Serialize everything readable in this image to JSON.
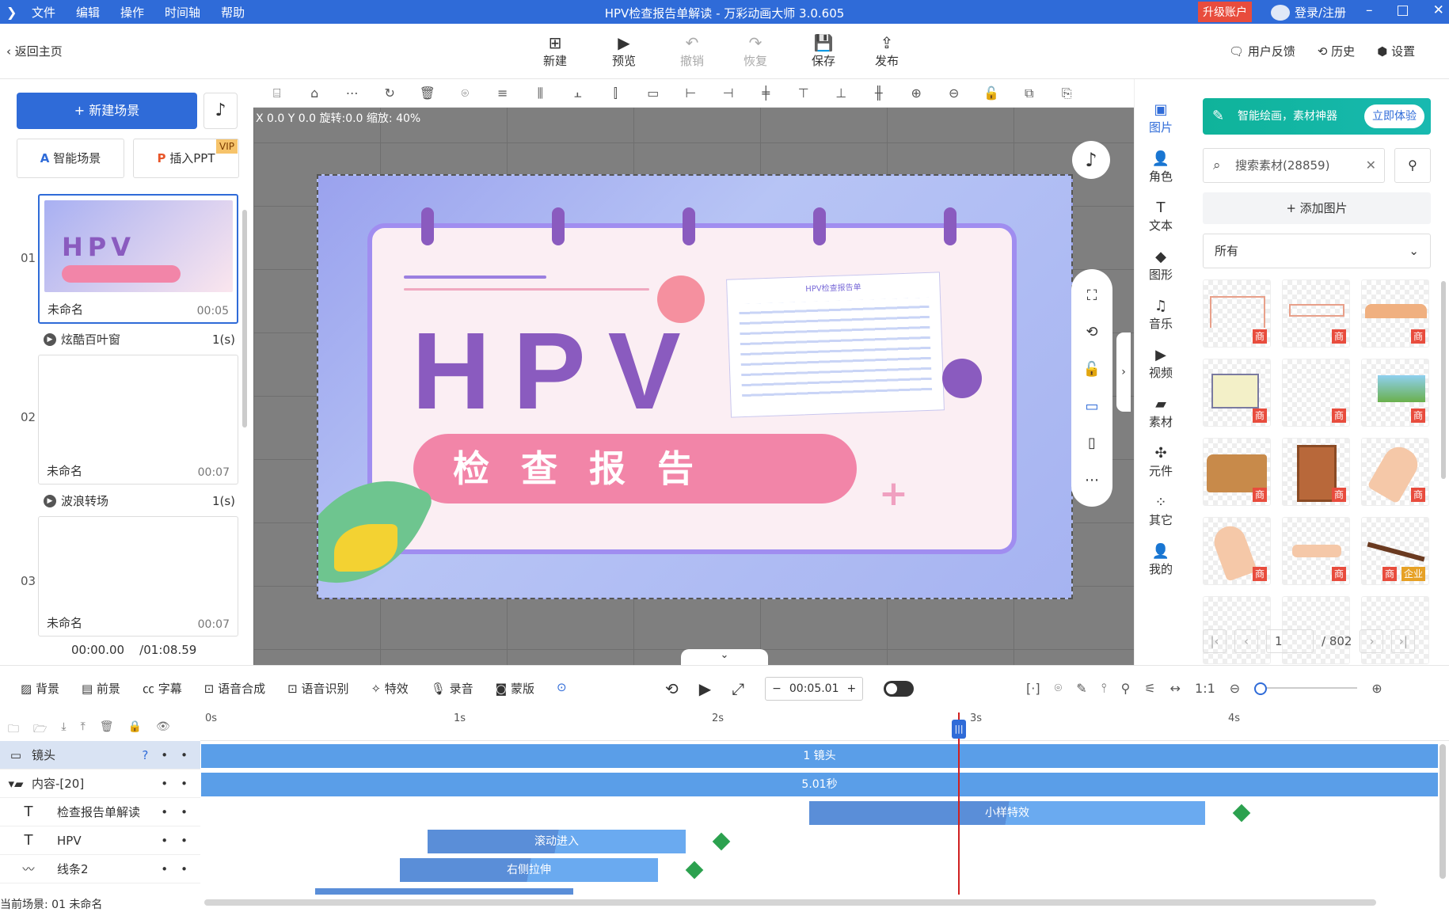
{
  "titlebar": {
    "menu": [
      "文件",
      "编辑",
      "操作",
      "时间轴",
      "帮助"
    ],
    "title": "HPV检查报告单解读 - 万彩动画大师 3.0.605",
    "upgrade": "升级账户",
    "login": "登录/注册",
    "controls": [
      "–",
      "□",
      "✕"
    ]
  },
  "toolbar": {
    "back": "返回主页",
    "buttons": [
      {
        "label": "新建",
        "icon": "⊞"
      },
      {
        "label": "预览",
        "icon": "▶"
      },
      {
        "label": "撤销",
        "icon": "↶"
      },
      {
        "label": "恢复",
        "icon": "↷"
      },
      {
        "label": "保存",
        "icon": "💾"
      },
      {
        "label": "发布",
        "icon": "⇪"
      }
    ],
    "right": [
      "用户反馈",
      "历史",
      "设置"
    ]
  },
  "left": {
    "new_scene": "+ 新建场景",
    "smart_scene": "智能场景",
    "insert_ppt": "插入PPT",
    "vip": "VIP",
    "scenes": [
      {
        "num": "01",
        "name": "未命名",
        "time": "00:05"
      },
      {
        "num": "02",
        "name": "未命名",
        "time": "00:07"
      },
      {
        "num": "03",
        "name": "未命名",
        "time": "00:07"
      }
    ],
    "transitions": [
      {
        "name": "炫酷百叶窗",
        "count": "1(s)"
      },
      {
        "name": "波浪转场",
        "count": "1(s)"
      }
    ],
    "time_current": "00:00.00",
    "time_total": "/01:08.59"
  },
  "canvas": {
    "coords": "X 0.0 Y 0.0 旋转:0.0 缩放: 40%",
    "hpv": "HPV",
    "banner": "检查报告",
    "report_title": "HPV检查报告单"
  },
  "rightnav": [
    "图片",
    "角色",
    "文本",
    "图形",
    "音乐",
    "视频",
    "素材",
    "元件",
    "其它",
    "我的"
  ],
  "assets": {
    "promo": "智能绘画，素材神器",
    "promo_btn": "立即体验",
    "search_placeholder": "搜索素材(28859)",
    "add_image": "+ 添加图片",
    "filter_all": "所有",
    "tag_shop": "商",
    "tag_enterprise": "企业",
    "page": "1",
    "total": "/ 802"
  },
  "ctrl": {
    "tools": [
      "背景",
      "前景",
      "字幕",
      "语音合成",
      "语音识别",
      "特效",
      "录音",
      "蒙版"
    ],
    "time": "00:05.01"
  },
  "timeline": {
    "ticks": [
      "0s",
      "1s",
      "2s",
      "3s",
      "4s"
    ],
    "layers": [
      {
        "name": "镜头",
        "track": "1 镜头"
      },
      {
        "name": "内容-[20]",
        "track": "5.01秒"
      },
      {
        "name": "检查报告单解读",
        "track": "小样特效"
      },
      {
        "name": "HPV",
        "track": "滚动进入"
      },
      {
        "name": "线条2",
        "track": "右侧拉伸"
      }
    ],
    "status": "当前场景: 01  未命名"
  }
}
